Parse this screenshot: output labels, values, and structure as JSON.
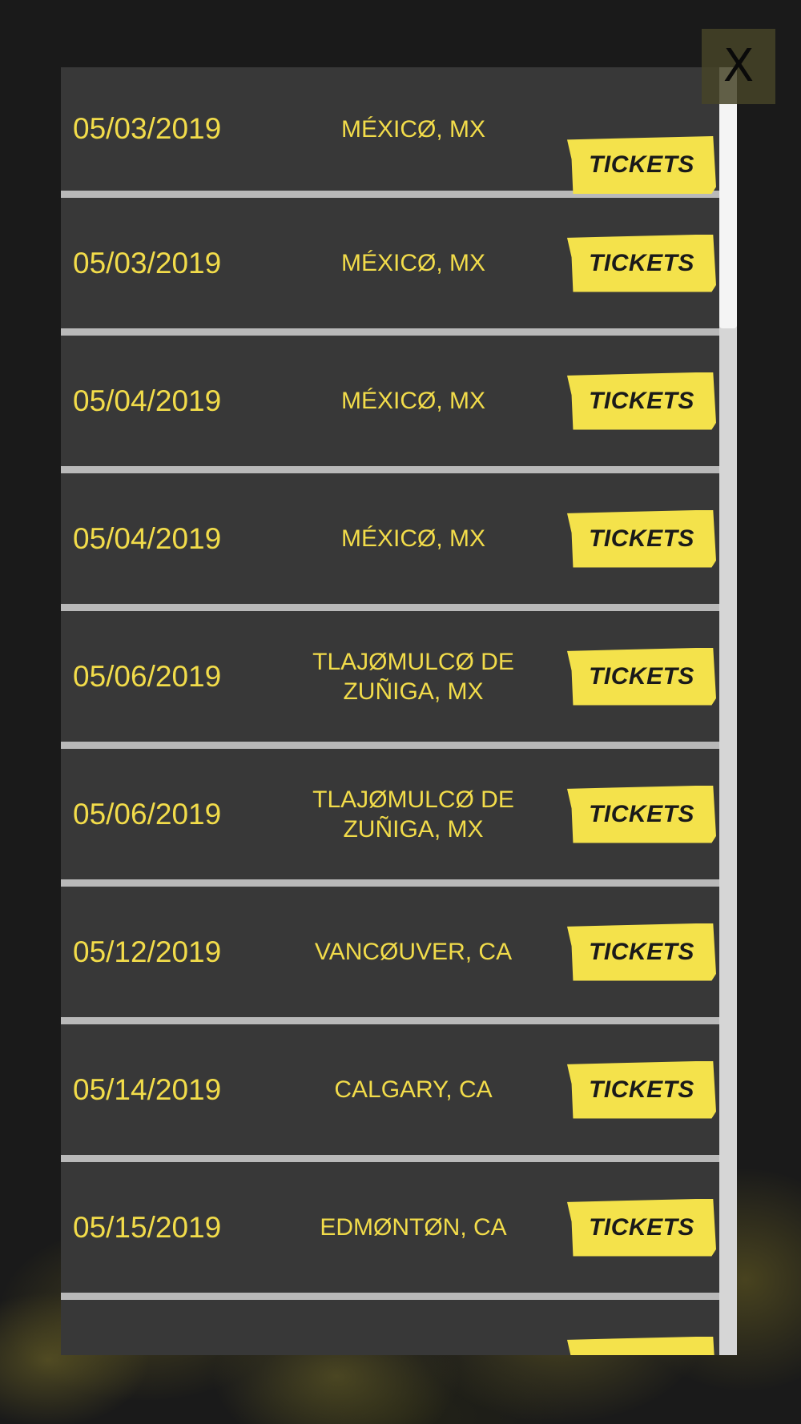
{
  "close_button": {
    "label": "X"
  },
  "tour_dates": [
    {
      "date": "05/03/2019",
      "city": "MÉXICØ, MX",
      "ticket_label": "TICKETS"
    },
    {
      "date": "05/03/2019",
      "city": "MÉXICØ, MX",
      "ticket_label": "TICKETS"
    },
    {
      "date": "05/04/2019",
      "city": "MÉXICØ, MX",
      "ticket_label": "TICKETS"
    },
    {
      "date": "05/04/2019",
      "city": "MÉXICØ, MX",
      "ticket_label": "TICKETS"
    },
    {
      "date": "05/06/2019",
      "city": "TLAJØMULCØ DE ZUÑIGA, MX",
      "ticket_label": "TICKETS"
    },
    {
      "date": "05/06/2019",
      "city": "TLAJØMULCØ DE ZUÑIGA, MX",
      "ticket_label": "TICKETS"
    },
    {
      "date": "05/12/2019",
      "city": "VANCØUVER, CA",
      "ticket_label": "TICKETS"
    },
    {
      "date": "05/14/2019",
      "city": "CALGARY, CA",
      "ticket_label": "TICKETS"
    },
    {
      "date": "05/15/2019",
      "city": "EDMØNTØN, CA",
      "ticket_label": "TICKETS"
    },
    {
      "date": "",
      "city": "",
      "ticket_label": ""
    }
  ],
  "colors": {
    "accent": "#f2dc4a",
    "ticket": "#f4e24b",
    "row_bg": "#383838",
    "divider": "#b9b9b9",
    "page_bg": "#1a1a1a"
  },
  "icons": {
    "close": "close-icon"
  }
}
